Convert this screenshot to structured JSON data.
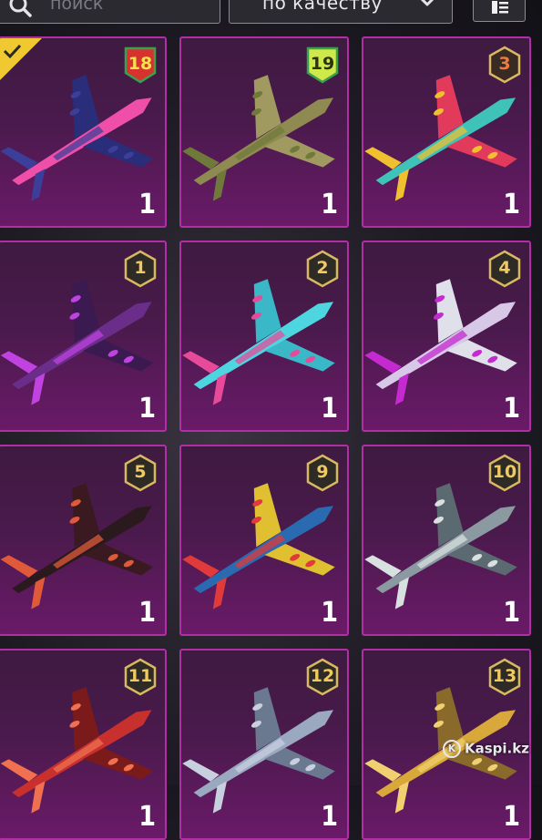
{
  "search": {
    "placeholder": "поиск",
    "icon": "search-icon"
  },
  "sort": {
    "label": "по качеству",
    "icon": "chevron-down-icon"
  },
  "view_toggle": {
    "icon": "list-view-icon"
  },
  "watermark": {
    "text": "Kaspi.kz",
    "logo_text": "K"
  },
  "items": [
    {
      "badge": "18",
      "badge_style": "tag",
      "badge_color": "#d7322e",
      "badge_text_color": "#f3e34c",
      "count": "1",
      "selected": true,
      "body": "#ef4fa8",
      "accent": "#3c3f9a",
      "wing": "#2a2d7a"
    },
    {
      "badge": "19",
      "badge_style": "tag",
      "badge_color": "#cfe84a",
      "badge_text_color": "#2b3410",
      "count": "1",
      "selected": false,
      "body": "#8e8a52",
      "accent": "#6f7a3a",
      "wing": "#a09a60"
    },
    {
      "badge": "3",
      "badge_style": "hex",
      "badge_color": "#3a2a24",
      "badge_text_color": "#f07a3a",
      "count": "1",
      "selected": false,
      "body": "#3fc3b8",
      "accent": "#f0c030",
      "wing": "#e23a5a"
    },
    {
      "badge": "1",
      "badge_style": "hex",
      "badge_color": "#2e2a26",
      "badge_text_color": "#f0c960",
      "count": "1",
      "selected": false,
      "body": "#6a2e8a",
      "accent": "#c042e0",
      "wing": "#3a1a50"
    },
    {
      "badge": "2",
      "badge_style": "hex",
      "badge_color": "#2e2a26",
      "badge_text_color": "#f0c960",
      "count": "1",
      "selected": false,
      "body": "#4ed6e0",
      "accent": "#e84a9a",
      "wing": "#3ab8c8"
    },
    {
      "badge": "4",
      "badge_style": "hex",
      "badge_color": "#2e2a26",
      "badge_text_color": "#f0c960",
      "count": "1",
      "selected": false,
      "body": "#d8c8e8",
      "accent": "#c42ad0",
      "wing": "#e0e0ea"
    },
    {
      "badge": "5",
      "badge_style": "hex",
      "badge_color": "#2e2a26",
      "badge_text_color": "#f0c960",
      "count": "1",
      "selected": false,
      "body": "#2a1a1e",
      "accent": "#e05a3a",
      "wing": "#3a1a20"
    },
    {
      "badge": "9",
      "badge_style": "hex",
      "badge_color": "#2e2a26",
      "badge_text_color": "#f0c960",
      "count": "1",
      "selected": false,
      "body": "#2a6ab0",
      "accent": "#e03a3a",
      "wing": "#e0c030"
    },
    {
      "badge": "10",
      "badge_style": "hex",
      "badge_color": "#2e2a26",
      "badge_text_color": "#f0c960",
      "count": "1",
      "selected": false,
      "body": "#8a9aa0",
      "accent": "#d8e0e0",
      "wing": "#5a6a70"
    },
    {
      "badge": "11",
      "badge_style": "hex",
      "badge_color": "#2e2a26",
      "badge_text_color": "#f0c960",
      "count": "1",
      "selected": false,
      "body": "#c8302e",
      "accent": "#f07050",
      "wing": "#7a1a1a"
    },
    {
      "badge": "12",
      "badge_style": "hex",
      "badge_color": "#2e2a26",
      "badge_text_color": "#f0c960",
      "count": "1",
      "selected": false,
      "body": "#9aa8c0",
      "accent": "#c8d0e0",
      "wing": "#6a7890"
    },
    {
      "badge": "13",
      "badge_style": "hex",
      "badge_color": "#2e2a26",
      "badge_text_color": "#f0c960",
      "count": "1",
      "selected": false,
      "body": "#d8a83a",
      "accent": "#f0d070",
      "wing": "#8a6a2a"
    }
  ]
}
